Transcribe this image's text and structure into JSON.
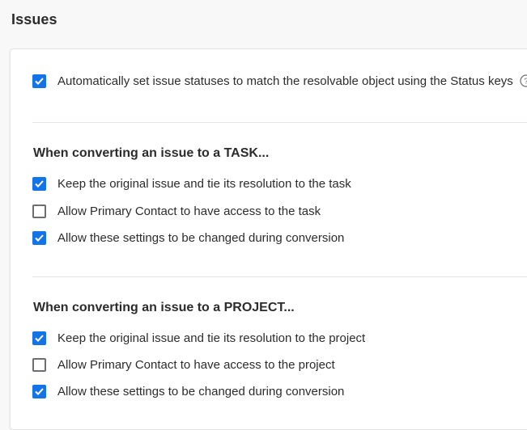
{
  "page": {
    "title": "Issues"
  },
  "auto_status": {
    "label": "Automatically set issue statuses to match the resolvable object using the Status keys",
    "checked": true,
    "help_icon": "question-circle-icon"
  },
  "task_section": {
    "heading": "When converting an issue to a TASK...",
    "options": [
      {
        "label": "Keep the original issue and tie its resolution to the task",
        "checked": true
      },
      {
        "label": "Allow Primary Contact to have access to the task",
        "checked": false
      },
      {
        "label": "Allow these settings to be changed during conversion",
        "checked": true
      }
    ]
  },
  "project_section": {
    "heading": "When converting an issue to a PROJECT...",
    "options": [
      {
        "label": "Keep the original issue and tie its resolution to the project",
        "checked": true
      },
      {
        "label": "Allow Primary Contact to have access to the project",
        "checked": false
      },
      {
        "label": "Allow these settings to be changed during conversion",
        "checked": true
      }
    ]
  },
  "colors": {
    "checkbox_checked": "#1473e6",
    "checkbox_border": "#6e6e6e",
    "text": "#2c2c2c",
    "background": "#f8f8f8"
  }
}
